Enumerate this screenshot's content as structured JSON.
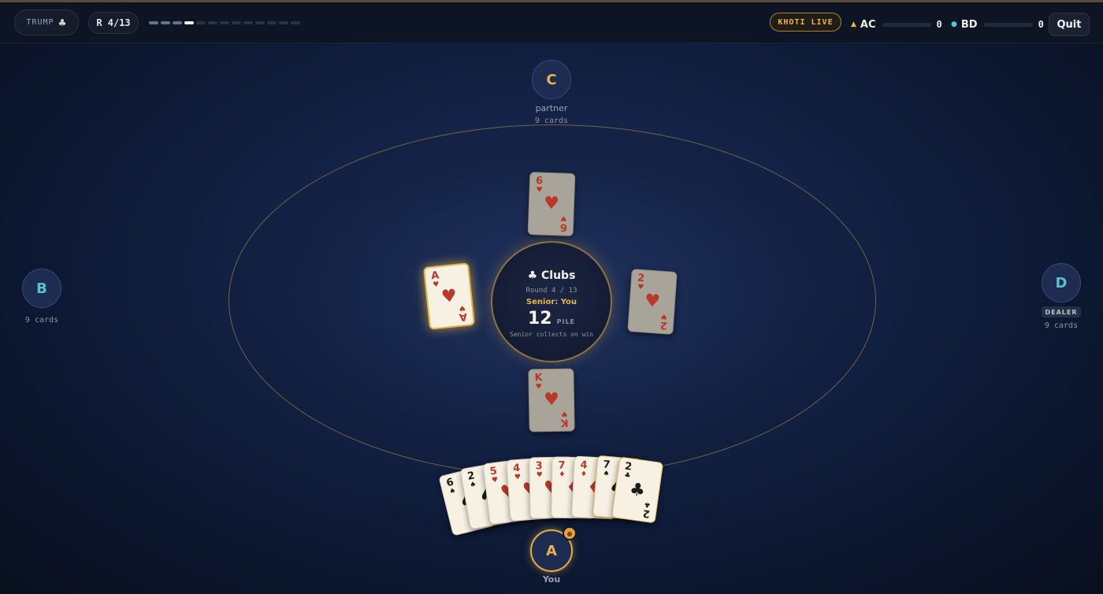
{
  "header": {
    "trump_label": "TRUMP",
    "trump_suit": "♣",
    "round_label": "R 4/13",
    "round_progress": {
      "completed": 3,
      "current": 4,
      "total": 13
    },
    "mode_badge": "KHOTI LIVE",
    "teams": [
      {
        "name": "AC",
        "score": "0",
        "marker": "▲",
        "color": "#e8b54a"
      },
      {
        "name": "BD",
        "score": "0",
        "marker": "●",
        "color": "#5bc7d4"
      }
    ],
    "quit_label": "Quit"
  },
  "players": {
    "top": {
      "initial": "C",
      "role": "partner",
      "cards": "9 cards"
    },
    "left": {
      "initial": "B",
      "cards": "9 cards"
    },
    "right": {
      "initial": "D",
      "badge": "DEALER",
      "cards": "9 cards"
    },
    "bottom": {
      "initial": "A",
      "label": "You"
    }
  },
  "center": {
    "trump_suit_icon": "♣",
    "trump_name": "Clubs",
    "round_text": "Round 4 / 13",
    "senior_text": "Senior: You",
    "pile_count": "12",
    "pile_label": "PILE",
    "collect_text": "Senior collects on win"
  },
  "played_cards": {
    "top": {
      "rank": "6",
      "suit": "♥"
    },
    "left": {
      "rank": "A",
      "suit": "♥"
    },
    "right": {
      "rank": "2",
      "suit": "♥"
    },
    "bottom": {
      "rank": "K",
      "suit": "♥"
    }
  },
  "hand": [
    {
      "rank": "6",
      "suit": "♠"
    },
    {
      "rank": "2",
      "suit": "♠"
    },
    {
      "rank": "5",
      "suit": "♥"
    },
    {
      "rank": "4",
      "suit": "♥"
    },
    {
      "rank": "3",
      "suit": "♥"
    },
    {
      "rank": "7",
      "suit": "♦"
    },
    {
      "rank": "4",
      "suit": "♦"
    },
    {
      "rank": "7",
      "suit": "♠"
    },
    {
      "rank": "2",
      "suit": "♣"
    }
  ]
}
